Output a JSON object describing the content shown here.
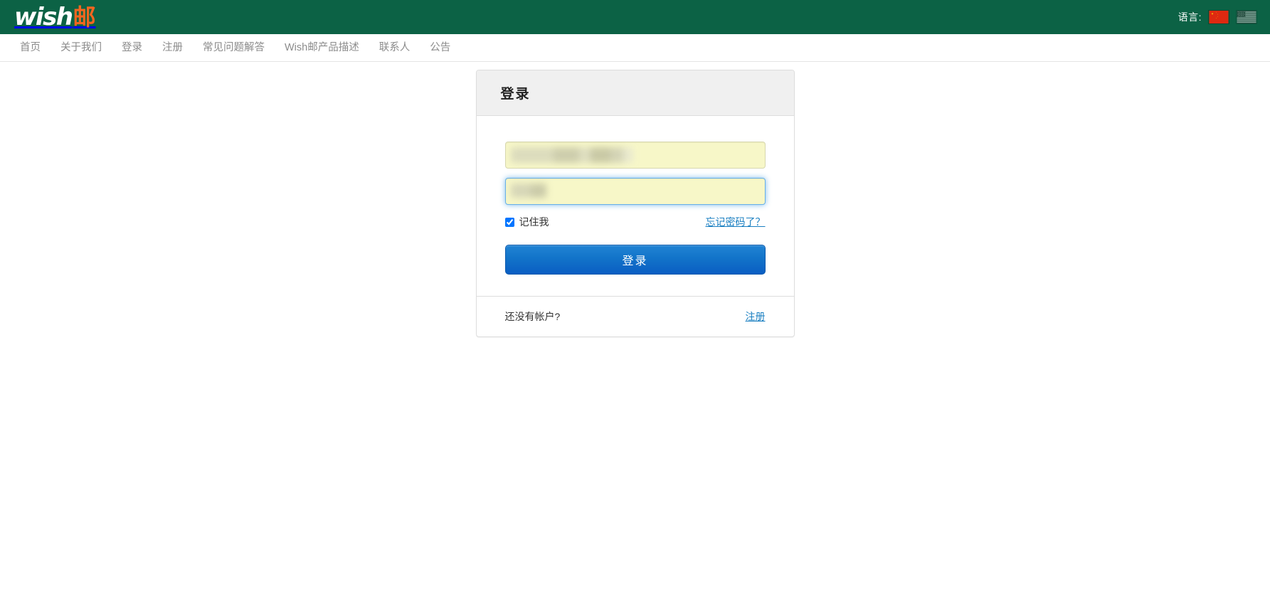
{
  "header": {
    "brand": {
      "name_latin": "wish",
      "name_cjk": "邮"
    },
    "language": {
      "label": "语言:",
      "options": [
        {
          "name": "chinese-flag",
          "code": "zh",
          "active": true
        },
        {
          "name": "us-flag",
          "code": "en",
          "active": false
        }
      ]
    },
    "background_color": "#0c6245",
    "accent_color": "#f4661f"
  },
  "nav": {
    "items": [
      {
        "label": "首页",
        "name": "nav-item-home"
      },
      {
        "label": "关于我们",
        "name": "nav-item-about-us"
      },
      {
        "label": "登录",
        "name": "nav-item-login"
      },
      {
        "label": "注册",
        "name": "nav-item-register"
      },
      {
        "label": "常见问题解答",
        "name": "nav-item-faq"
      },
      {
        "label": "Wish邮产品描述",
        "name": "nav-item-product-description"
      },
      {
        "label": "联系人",
        "name": "nav-item-contact"
      },
      {
        "label": "公告",
        "name": "nav-item-announcements"
      }
    ]
  },
  "login_panel": {
    "title": "登录",
    "username": {
      "value": "",
      "placeholder": ""
    },
    "password": {
      "value": "",
      "placeholder": ""
    },
    "remember_me": {
      "label": "记住我",
      "checked": true
    },
    "forgot_password_link": "忘记密码了？",
    "submit_label": "登录",
    "footer": {
      "prompt": "还没有帐户?",
      "register_link": "注册"
    },
    "link_color": "#1a7fc1",
    "button_color": "#1274c9",
    "autofill_color": "#f7f7c8",
    "focus_color": "#66afe9"
  }
}
